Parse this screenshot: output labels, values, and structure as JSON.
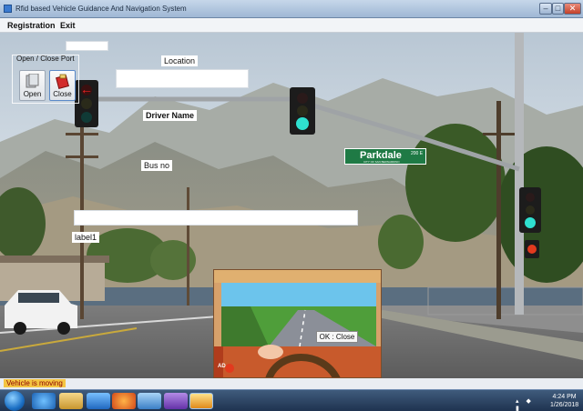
{
  "window": {
    "title": "Rfid based Vehicle Guidance And Navigation System",
    "min_glyph": "–",
    "max_glyph": "□",
    "close_glyph": "✕"
  },
  "menu": {
    "items": [
      "Registration",
      "Exit"
    ]
  },
  "port_group": {
    "legend": "Open / Close Port",
    "open_label": "Open",
    "close_label": "Close",
    "open_icon": "port-open-icon",
    "close_icon": "port-close-icon"
  },
  "form": {
    "location_label": "Location",
    "location_value": "",
    "driver_label": "Driver Name",
    "busno_label": "Bus no",
    "label1": "label1",
    "top_box_value": "",
    "wide_box_value": ""
  },
  "scene": {
    "street_sign_name": "Parkdale",
    "street_sign_num": "200 E",
    "street_sign_sub": "CITY OF SAN BERNARDINO",
    "signal_color": "#2fe0d0",
    "stop_color": "#e23a1e"
  },
  "inset": {
    "ok_close_label": "OK : Close",
    "ad_badge": "AD"
  },
  "status": {
    "text": "Vehicle is moving"
  },
  "taskbar": {
    "time": "4:24 PM",
    "date": "1/26/2018",
    "apps": [
      "ie-icon",
      "explorer-icon",
      "media-icon",
      "firefox-icon",
      "paint-icon",
      "visual-studio-icon",
      "running-app-icon"
    ]
  }
}
